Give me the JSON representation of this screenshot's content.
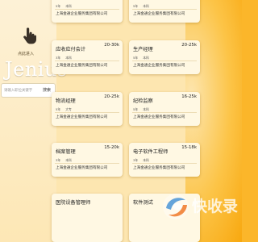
{
  "sidebar": {
    "cursor_label": "点此进入",
    "logo_text": "Jenius",
    "search_placeholder": "请输入职位关键字",
    "search_button": "搜索"
  },
  "jobs": [
    {
      "title": "",
      "salary": "",
      "experience": "5年",
      "education": "本科",
      "company": "上海金通企业服务集团有限公司"
    },
    {
      "title": "",
      "salary": "",
      "experience": "5年",
      "education": "本科",
      "company": "上海金通企业服务集团有限公司"
    },
    {
      "title": "应收应付会计",
      "salary": "20-30k",
      "experience": "3年",
      "education": "本科",
      "company": "上海金通企业服务集团有限公司"
    },
    {
      "title": "生产经理",
      "salary": "20-25k",
      "experience": "5年",
      "education": "本科",
      "company": "上海金通企业服务集团有限公司"
    },
    {
      "title": "物流经理",
      "salary": "20-25k",
      "experience": "5年",
      "education": "大专",
      "company": "上海金通企业服务集团有限公司"
    },
    {
      "title": "纪检监察",
      "salary": "16-25k",
      "experience": "5年",
      "education": "本科",
      "company": "上海金通企业服务集团有限公司"
    },
    {
      "title": "档案管理",
      "salary": "15-20k",
      "experience": "3年",
      "education": "本科",
      "company": "上海金通企业服务集团有限公司"
    },
    {
      "title": "电子软件工程师",
      "salary": "15-18k",
      "experience": "3年",
      "education": "本科",
      "company": "上海金通企业服务集团有限公司"
    },
    {
      "title": "医院设备管理师",
      "salary": "",
      "experience": "",
      "education": "",
      "company": ""
    },
    {
      "title": "软件测试",
      "salary": "",
      "experience": "",
      "education": "",
      "company": ""
    }
  ],
  "watermark": {
    "text": "快收录"
  },
  "colors": {
    "background": "#fbb62a",
    "card": "#fff8e3"
  }
}
